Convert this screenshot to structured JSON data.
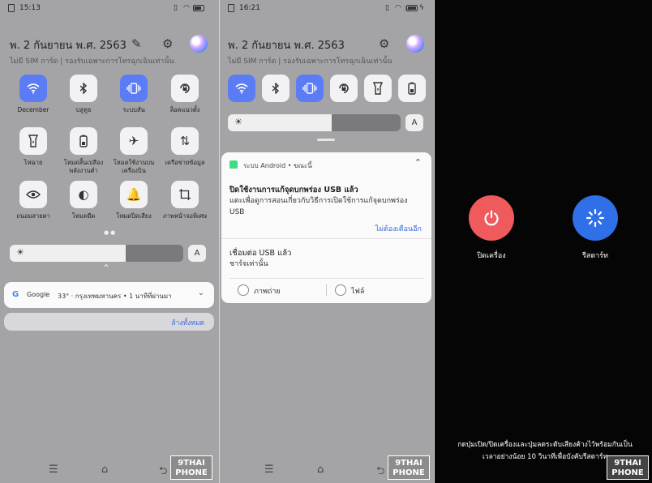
{
  "screen1": {
    "time": "15:13",
    "date": "พ. 2 กันยายน พ.ศ. 2563",
    "sim_text": "ไม่มี SIM การ์ด | รองรับเฉพาะการโทรฉุกเฉินเท่านั้น",
    "battery_level": 0.75,
    "brightness_level": 0.67,
    "tiles": [
      {
        "label": "December",
        "icon": "wifi-icon",
        "on": true
      },
      {
        "label": "บลูทูธ",
        "icon": "bluetooth-icon",
        "on": false
      },
      {
        "label": "ระบบสั่น",
        "icon": "vibrate-icon",
        "on": true
      },
      {
        "label": "ล็อคแนวตั้ง",
        "icon": "rotation-lock-icon",
        "on": false
      },
      {
        "label": "ไฟฉาย",
        "icon": "flashlight-icon",
        "on": false
      },
      {
        "label": "โหมดสิ้นเปลืองพลังงานต่ำ",
        "icon": "battery-saver-icon",
        "on": false
      },
      {
        "label": "โหมดใช้งานบนเครื่องบิน",
        "icon": "airplane-icon",
        "on": false
      },
      {
        "label": "เครือข่ายข้อมูล",
        "icon": "mobile-data-icon",
        "on": false
      },
      {
        "label": "ถนอมสายตา",
        "icon": "eye-icon",
        "on": false
      },
      {
        "label": "โหมดมืด",
        "icon": "dark-mode-icon",
        "on": false
      },
      {
        "label": "โหมดปิดเสียง",
        "icon": "bell-icon",
        "on": false
      },
      {
        "label": "ภาพหน้าจอพิเศษ",
        "icon": "screenshot-icon",
        "on": false
      }
    ],
    "auto_brightness_label": "A",
    "google_card": {
      "app": "Google",
      "text": "33° · กรุงเทพมหานคร • 1 นาทีที่ผ่านมา"
    },
    "clear_all": "ล้างทั้งหมด"
  },
  "screen2": {
    "time": "16:21",
    "date": "พ. 2 กันยายน พ.ศ. 2563",
    "sim_text": "ไม่มี SIM การ์ด | รองรับเฉพาะการโทรฉุกเฉินเท่านั้น",
    "brightness_level": 0.6,
    "auto_brightness_label": "A",
    "quick_tiles": [
      {
        "icon": "wifi-icon",
        "on": true
      },
      {
        "icon": "bluetooth-icon",
        "on": false
      },
      {
        "icon": "vibrate-icon",
        "on": true
      },
      {
        "icon": "rotation-lock-icon",
        "on": false
      },
      {
        "icon": "flashlight-icon",
        "on": false
      },
      {
        "icon": "battery-saver-icon",
        "on": false
      }
    ],
    "notification": {
      "source": "ระบบ Android • ขณะนี้",
      "usb_debug_title": "ปิดใช้งานการแก้จุดบกพร่อง USB แล้ว",
      "usb_debug_text": "แตะเพื่อดูการสอนเกี่ยวกับวิธีการเปิดใช้การแก้จุดบกพร่อง USB",
      "dismiss": "ไม่ต้องเตือนอีก",
      "usb_conn_title": "เชื่อมต่อ USB แล้ว",
      "usb_conn_text": "ชาร์จเท่านั้น",
      "option1": "ภาพถ่าย",
      "option2": "ไฟล์"
    }
  },
  "screen3": {
    "power_off_label": "ปิดเครื่อง",
    "restart_label": "รีสตาร์ท",
    "hint_line1": "กดปุ่มเปิด/ปิดเครื่องและปุ่มลดระดับเสียงค้างไว้พร้อมกันเป็น",
    "hint_line2": "เวลาอย่างน้อย 10 วินาทีเพื่อบังคับรีสตาร์ท",
    "power_color": "#ef5a5d",
    "restart_color": "#2f6fe8"
  },
  "watermark": {
    "line1": "9THAI",
    "line2": "PHONE"
  }
}
